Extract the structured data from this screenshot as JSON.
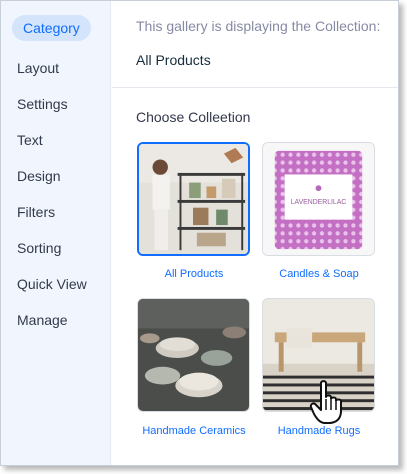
{
  "sidebar": {
    "items": [
      {
        "label": "Category",
        "active": true
      },
      {
        "label": "Layout"
      },
      {
        "label": "Settings"
      },
      {
        "label": "Text"
      },
      {
        "label": "Design"
      },
      {
        "label": "Filters"
      },
      {
        "label": "Sorting"
      },
      {
        "label": "Quick View"
      },
      {
        "label": "Manage"
      }
    ]
  },
  "main": {
    "info_text": "This gallery is displaying the Collection:",
    "current_collection": "All Products",
    "section_title": "Choose Colleetion",
    "collections": [
      {
        "label": "All Products",
        "selected": true
      },
      {
        "label": "Candles & Soap",
        "product_brand": "LAVENDERLILAC"
      },
      {
        "label": "Handmade Ceramics"
      },
      {
        "label": "Handmade Rugs"
      }
    ]
  },
  "colors": {
    "accent": "#116dff",
    "active_bg": "#d4e4fb",
    "sidebar_bg": "#f1f6fe",
    "text": "#32394a",
    "muted": "#868aa5"
  }
}
